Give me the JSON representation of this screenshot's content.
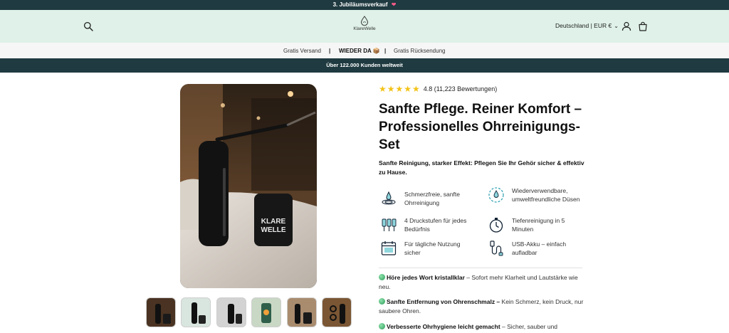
{
  "announcement": {
    "text": "3. Jubiläumsverkauf",
    "heart": "❤"
  },
  "header": {
    "logo_text": "KlareWelle",
    "country": "Deutschland | EUR €",
    "chevron": "⌄"
  },
  "usp_bar": {
    "item1": "Gratis Versand",
    "sep": "|",
    "item2": "WIEDER DA 📦",
    "item3": "Gratis Rücksendung"
  },
  "trust_bar": {
    "text": "Über 122.000 Kunden weltweit"
  },
  "product": {
    "stars": "★★★★★",
    "rating_text": "4.8 (11,223 Bewertungen)",
    "rating": 4.8,
    "title": "Sanfte Pflege. Reiner Komfort – Professionelles Ohrreinigungs-Set",
    "subtitle": "Sanfte Reinigung, starker Effekt: Pflegen Sie Ihr Gehör sicher & effektiv zu Hause.",
    "image_label": "KLARE WELLE"
  },
  "features": [
    {
      "icon": "fountain-icon",
      "text": "Schmerzfreie, sanfte Ohrreinigung"
    },
    {
      "icon": "recycle-drop-icon",
      "text": "Wiederverwendbare, umweltfreundliche Düsen"
    },
    {
      "icon": "pressure-levels-icon",
      "text": "4 Druckstufen für jedes Bedürfnis"
    },
    {
      "icon": "stopwatch-icon",
      "text": "Tiefenreinigung in 5 Minuten"
    },
    {
      "icon": "calendar-icon",
      "text": "Für tägliche Nutzung sicher"
    },
    {
      "icon": "usb-cable-icon",
      "text": "USB-Akku – einfach aufladbar"
    }
  ],
  "bullets": [
    {
      "bold": "Höre jedes Wort kristallklar",
      "rest": " – Sofort mehr Klarheit und Lautstärke wie neu."
    },
    {
      "bold": "Sanfte Entfernung von Ohrenschmalz –",
      "rest": " Kein Schmerz, kein Druck, nur saubere Ohren."
    },
    {
      "bold": "Verbesserte Ohrhygiene leicht gemacht",
      "rest": " – Sicher, sauber und"
    }
  ],
  "colors": {
    "dark_bar": "#1f3a40",
    "header_bg": "#dff1e8",
    "star": "#f3c316"
  }
}
